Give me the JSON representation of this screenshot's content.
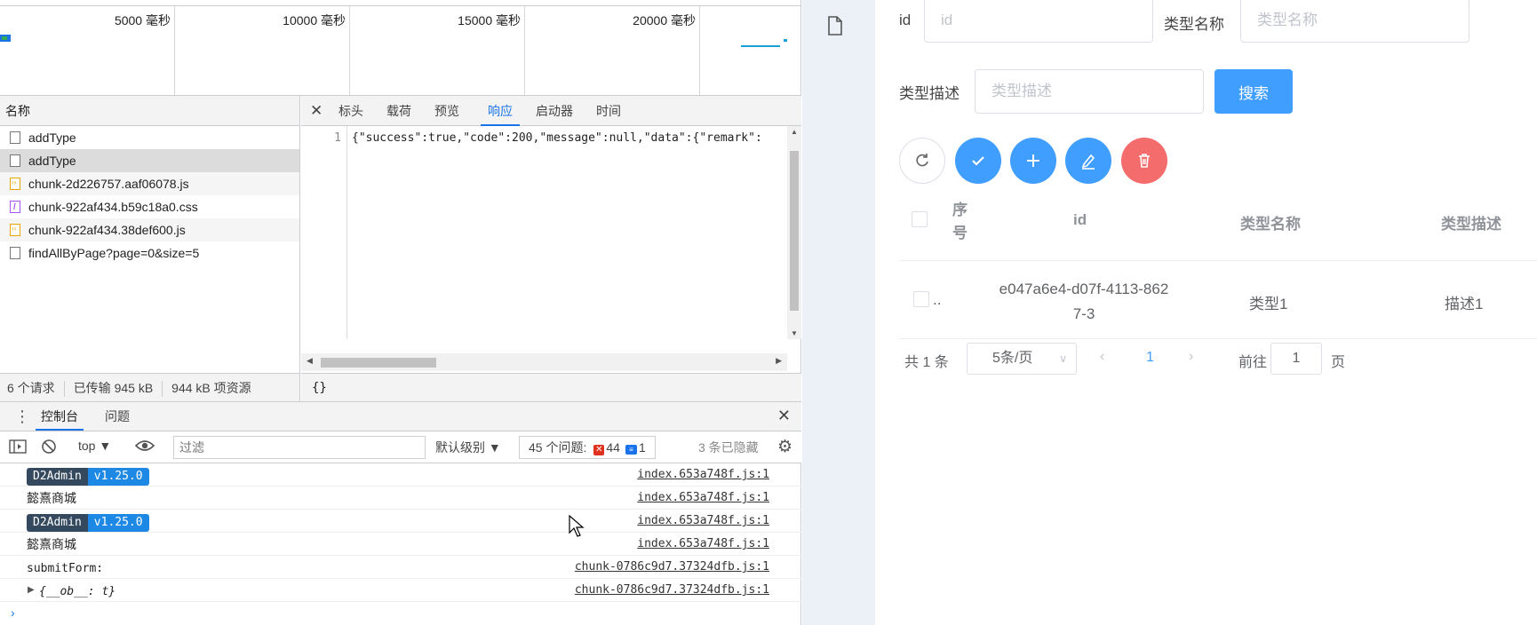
{
  "devtools": {
    "timeline": {
      "labels": [
        "5000 毫秒",
        "10000 毫秒",
        "15000 毫秒",
        "20000 毫秒"
      ]
    },
    "requests": {
      "header": "名称",
      "items": [
        {
          "name": "addType",
          "type": "xhr"
        },
        {
          "name": "addType",
          "type": "xhr"
        },
        {
          "name": "chunk-2d226757.aaf06078.js",
          "type": "js"
        },
        {
          "name": "chunk-922af434.b59c18a0.css",
          "type": "css"
        },
        {
          "name": "chunk-922af434.38def600.js",
          "type": "js"
        },
        {
          "name": "findAllByPage?page=0&size=5",
          "type": "xhr"
        }
      ],
      "status": {
        "count": "6 个请求",
        "transferred": "已传输 945 kB",
        "resources": "944 kB 项资源"
      }
    },
    "response": {
      "tabs": [
        "标头",
        "载荷",
        "预览",
        "响应",
        "启动器",
        "时间"
      ],
      "active_tab": "响应",
      "line_number": "1",
      "body": "{\"success\":true,\"code\":200,\"message\":null,\"data\":{\"remark\":",
      "footer": "{}"
    },
    "drawer": {
      "tabs": [
        "控制台",
        "问题"
      ],
      "active_tab": "控制台"
    },
    "console_toolbar": {
      "context": "top",
      "filter_placeholder": "过滤",
      "level": "默认级别",
      "issues_label": "45 个问题:",
      "errors": "44",
      "infos": "1",
      "hidden": "3 条已隐藏"
    },
    "logs": [
      {
        "kind": "tag",
        "tag": "D2Admin",
        "version": "v1.25.0",
        "source": "index.653a748f.js:1"
      },
      {
        "kind": "text",
        "text": "懿熹商城",
        "source": "index.653a748f.js:1"
      },
      {
        "kind": "tag",
        "tag": "D2Admin",
        "version": "v1.25.0",
        "source": "index.653a748f.js:1"
      },
      {
        "kind": "text",
        "text": "懿熹商城",
        "source": "index.653a748f.js:1"
      },
      {
        "kind": "mono",
        "text": "submitForm:",
        "source": "chunk-0786c9d7.37324dfb.js:1"
      },
      {
        "kind": "obj",
        "text": "{__ob__: t}",
        "source": "chunk-0786c9d7.37324dfb.js:1"
      }
    ]
  },
  "app": {
    "form": {
      "id_label": "id",
      "id_placeholder": "id",
      "name_label": "类型名称",
      "name_placeholder": "类型名称",
      "desc_label": "类型描述",
      "desc_placeholder": "类型描述",
      "search_button": "搜索"
    },
    "table": {
      "headers": {
        "index": "序号",
        "id": "id",
        "name": "类型名称",
        "desc": "类型描述"
      },
      "rows": [
        {
          "index": "..",
          "id_line1": "e047a6e4-d07f-4113-862",
          "id_line2": "7-3",
          "name": "类型1",
          "desc": "描述1"
        }
      ]
    },
    "pagination": {
      "total": "共 1 条",
      "page_size": "5条/页",
      "current_page": "1",
      "goto_label": "前往",
      "goto_value": "1",
      "page_suffix": "页"
    },
    "colors": {
      "primary": "#409eff",
      "danger": "#f56c6c"
    }
  }
}
